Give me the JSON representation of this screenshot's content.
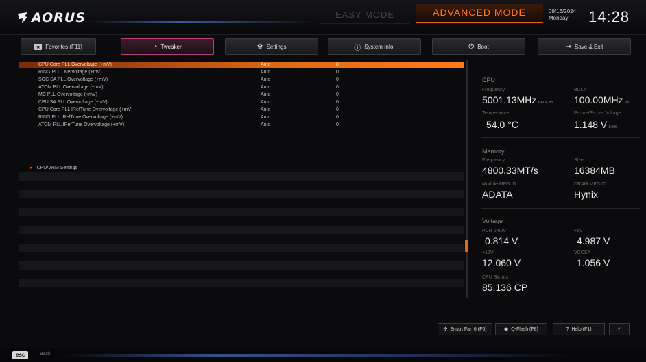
{
  "header": {
    "brand": "AORUS",
    "mode_easy": "EASY MODE",
    "mode_advanced": "ADVANCED MODE",
    "date": "09/16/2024",
    "weekday": "Monday",
    "time": "14:28"
  },
  "tabs": [
    {
      "label": "Favorites (F11)",
      "icon": "star-box-icon"
    },
    {
      "label": "Tweaker",
      "icon": "speedometer-icon",
      "active": true
    },
    {
      "label": "Settings",
      "icon": "settings-icon"
    },
    {
      "label": "System Info.",
      "icon": "info-icon"
    },
    {
      "label": "Boot",
      "icon": "power-icon"
    },
    {
      "label": "Save & Exit",
      "icon": "exit-icon"
    }
  ],
  "settings": [
    {
      "name": "CPU Core PLL Overvoltage (+mV)",
      "value": "Auto",
      "value2": "0",
      "highlighted": true
    },
    {
      "name": "RING PLL Overvoltage (+mV)",
      "value": "Auto",
      "value2": "0"
    },
    {
      "name": "SOC SA PLL Overvoltage (+mV)",
      "value": "Auto",
      "value2": "0"
    },
    {
      "name": "ATOM PLL Overvoltage (+mV)",
      "value": "Auto",
      "value2": "0"
    },
    {
      "name": "MC PLL Overvoltage (+mV)",
      "value": "Auto",
      "value2": "0"
    },
    {
      "name": "CPU SA PLL Overvoltage (+mV)",
      "value": "Auto",
      "value2": "0"
    },
    {
      "name": "CPU Core PLL IRefTune Overvoltage (+mV)",
      "value": "Auto",
      "value2": "0"
    },
    {
      "name": "RING PLL IRefTune Overvoltage (+mV)",
      "value": "Auto",
      "value2": "0"
    },
    {
      "name": "ATOM PLL IRefTune Overvoltage (+mV)",
      "value": "Auto",
      "value2": "0"
    }
  ],
  "submenu": {
    "label": "CPU/VRM Settings"
  },
  "cpu": {
    "title": "CPU",
    "freq_label": "Frequency",
    "freq_value": "5001.13MHz",
    "freq_unit": "MADE BY",
    "bclk_label": "BCLK",
    "bclk_value": "100.00MHz",
    "bclk_unit": "100",
    "temp_label": "Temperature",
    "temp_value": "54.0 °C",
    "volt_label": "P-core/E-core Voltage",
    "volt_value": "1.148 V",
    "volt_unit": "1.006"
  },
  "memory": {
    "title": "Memory",
    "freq_label": "Frequency",
    "freq_value": "4800.33MT/s",
    "size_label": "Size",
    "size_value": "16384MB",
    "module_label": "Module MFG ID",
    "module_value": "ADATA",
    "dram_label": "DRAM MFG ID",
    "dram_value": "Hynix"
  },
  "voltage": {
    "title": "Voltage",
    "pch_label": "PCH 0.82V",
    "pch_value": "0.814 V",
    "v5_label": "+5V",
    "v5_value": "4.987 V",
    "v12_label": "+12V",
    "v12_value": "12.060 V",
    "vccsa_label": "VCCSA",
    "vccsa_value": "1.056 V",
    "bclk_label": "CPU Bicruts",
    "bclk_value": "85.136 CP"
  },
  "bottom_buttons": [
    {
      "label": "Smart Fan 6 (F6)",
      "icon": "fan-icon"
    },
    {
      "label": "Q-Flash (F8)",
      "icon": "flash-disk-icon"
    },
    {
      "label": "Help (F1)",
      "icon": "help-icon"
    },
    {
      "label": "",
      "icon": "search-icon"
    }
  ],
  "footer": {
    "esc_key": "esc",
    "esc_label": "Back"
  },
  "colors": {
    "accent": "#e06a14",
    "active_tab_border": "#b8407a"
  }
}
